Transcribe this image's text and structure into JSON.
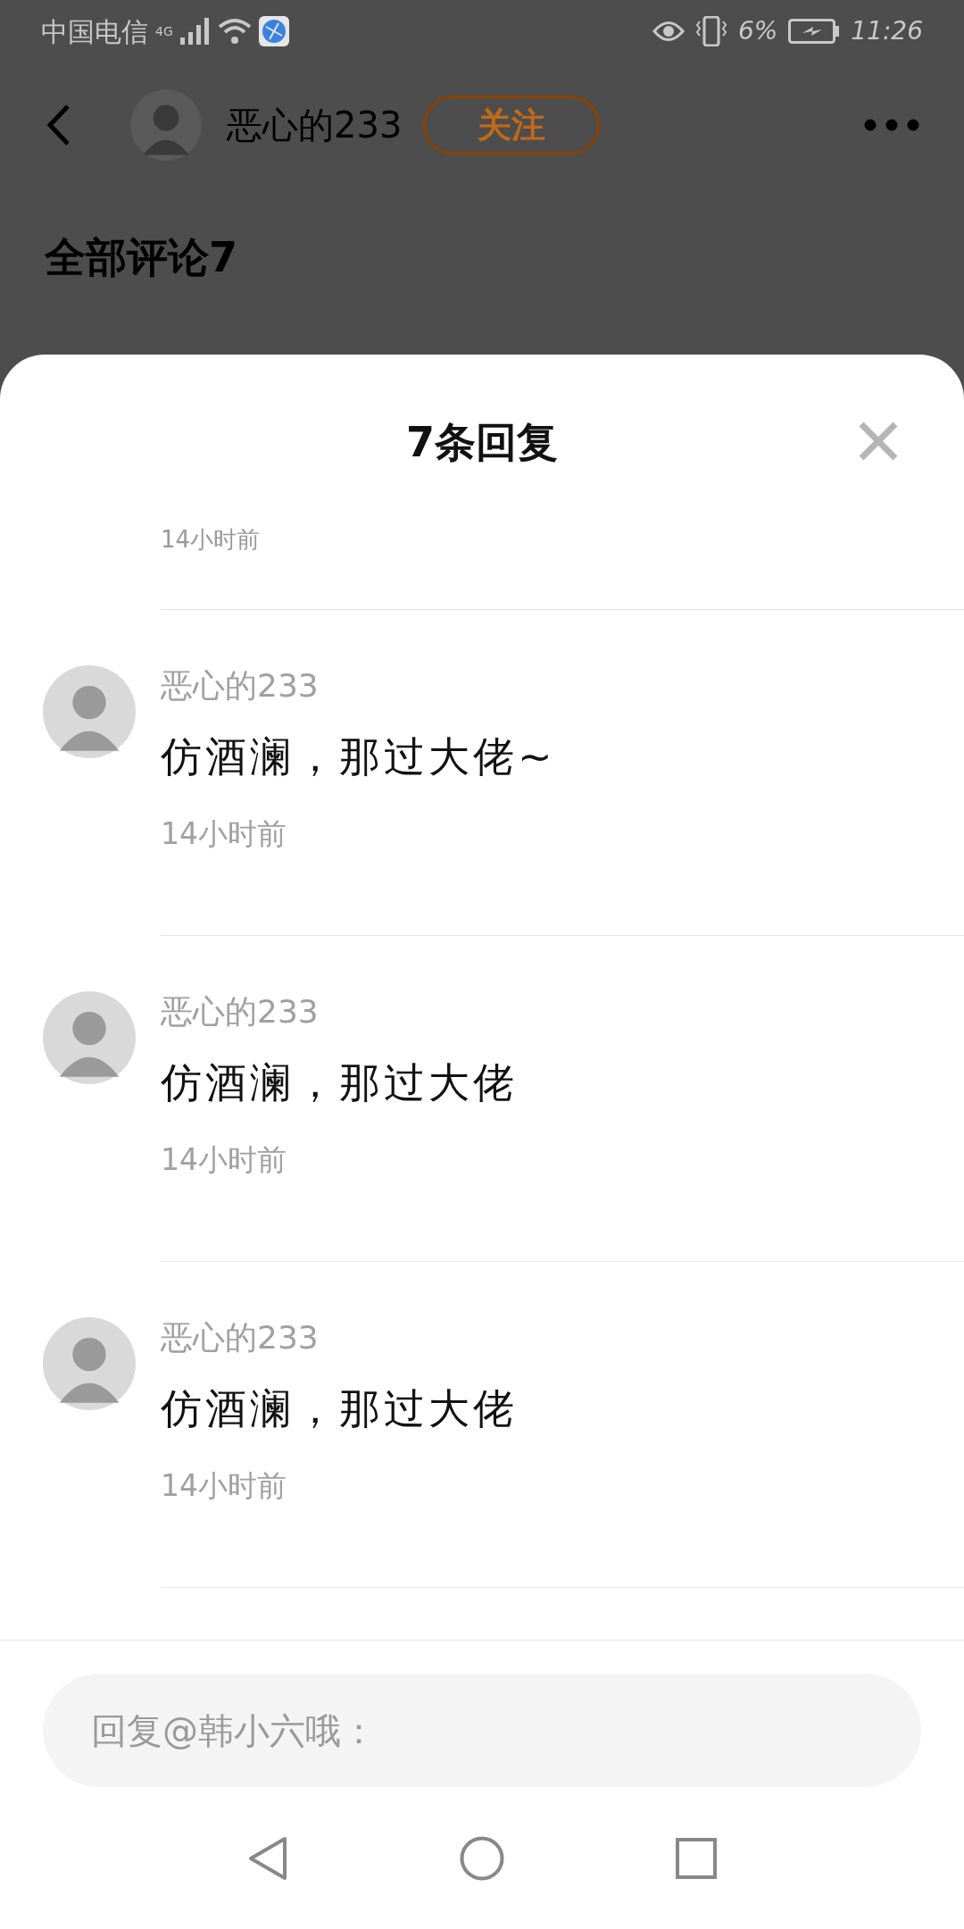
{
  "status_bar": {
    "carrier": "中国电信",
    "network": "4G",
    "battery": "6%",
    "time": "11:26"
  },
  "header": {
    "username": "恶心的233",
    "follow_button": "关注"
  },
  "section_title": "全部评论7",
  "sheet": {
    "title": "7条回复",
    "partial_time": "14小时前",
    "comments": [
      {
        "author": "恶心的233",
        "text": "仿酒澜，那过大佬~",
        "time": "14小时前"
      },
      {
        "author": "恶心的233",
        "text": "仿酒澜，那过大佬",
        "time": "14小时前"
      },
      {
        "author": "恶心的233",
        "text": "仿酒澜，那过大佬",
        "time": "14小时前"
      }
    ]
  },
  "reply_box": {
    "placeholder": "回复@韩小六哦："
  }
}
